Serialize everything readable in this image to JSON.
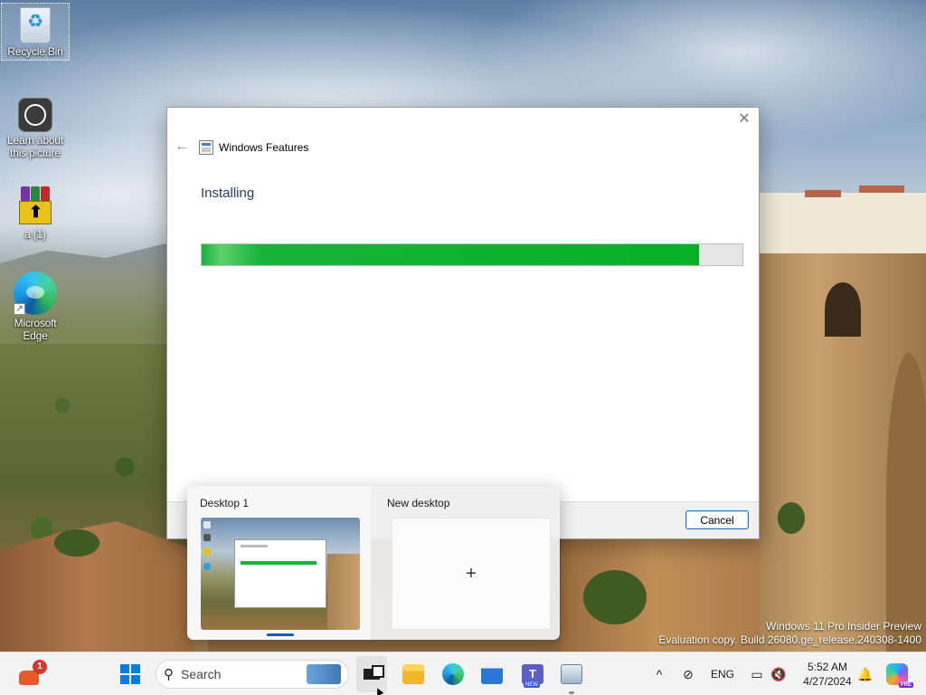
{
  "desktop": {
    "icons": [
      {
        "label": "Recycle Bin"
      },
      {
        "label": "Learn about this picture"
      },
      {
        "label": "a (1)"
      },
      {
        "label": "Microsoft Edge"
      }
    ]
  },
  "dialog": {
    "title": "Windows Features",
    "heading": "Installing",
    "progress_fraction": 0.92,
    "cancel_label": "Cancel",
    "close_glyph": "✕",
    "back_glyph": "←"
  },
  "taskview": {
    "desktops": [
      {
        "label": "Desktop 1"
      },
      {
        "label": "New desktop"
      }
    ],
    "add_glyph": "+"
  },
  "watermark": {
    "line1": "Windows 11 Pro Insider Preview",
    "line2": "Evaluation copy. Build 26080.ge_release.240308-1400"
  },
  "taskbar": {
    "widget_badge": "1",
    "search_placeholder": "Search",
    "search_glyph": "⚲",
    "teams_letter": "T",
    "teams_badge": "NEW",
    "apps": [
      "File Explorer",
      "Microsoft Edge",
      "Microsoft Store",
      "Microsoft Teams",
      "Control Panel"
    ],
    "tray": {
      "chevron": "^",
      "network_glyph": "⊘",
      "language": "ENG",
      "display_glyph": "▭",
      "sound_glyph": "🔇",
      "time": "5:52 AM",
      "date": "4/27/2024",
      "notify_glyph": "🔔",
      "copilot_badge": "PRE"
    }
  },
  "colors": {
    "progress_green": "#06b025",
    "accent_blue": "#005fb8",
    "dialog_heading": "#1f3d7a"
  }
}
